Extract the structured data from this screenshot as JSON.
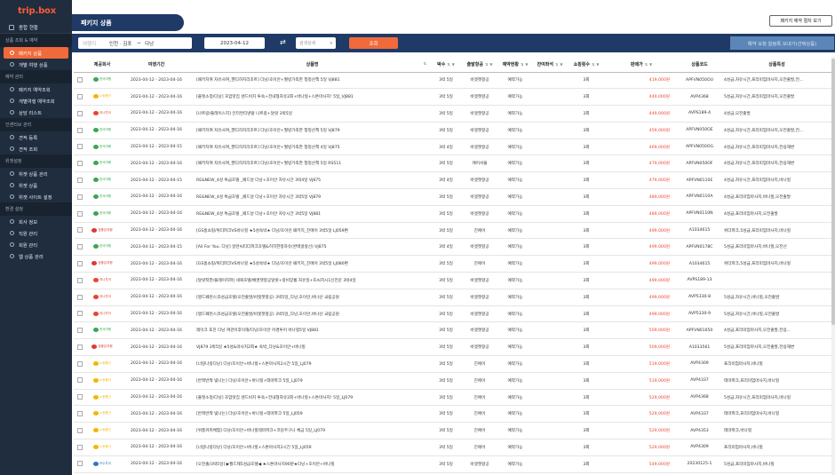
{
  "sidebar": {
    "logo": "trip.box",
    "top_item": "종합 현황",
    "sections": [
      {
        "title": "상품 조회 & 예약",
        "items": [
          {
            "label": "패키지 상품",
            "active": true
          },
          {
            "label": "개별 여행 상품",
            "active": false
          }
        ]
      },
      {
        "title": "예약 관리",
        "items": [
          {
            "label": "패키지 예약조회",
            "active": false
          },
          {
            "label": "개별여행 예약조회",
            "active": false
          },
          {
            "label": "상담 리스트",
            "active": false
          }
        ]
      },
      {
        "title": "인센티브 관리",
        "items": [
          {
            "label": "견적 등록",
            "active": false
          },
          {
            "label": "견적 조회",
            "active": false
          }
        ]
      },
      {
        "title": "위젯설정",
        "items": [
          {
            "label": "위젯 상품 관리",
            "active": false
          },
          {
            "label": "위젯 상품",
            "active": false
          },
          {
            "label": "위젯 사이트 설정",
            "active": false
          }
        ]
      },
      {
        "title": "환경 설정",
        "items": [
          {
            "label": "회사 정보",
            "active": false
          },
          {
            "label": "직원 관리",
            "active": false
          },
          {
            "label": "회원 관리",
            "active": false
          },
          {
            "label": "웹 상품 관리",
            "active": false
          }
        ]
      }
    ]
  },
  "header": {
    "title": "패키지 상품",
    "guide_button": "패키지 예약 절차 보기"
  },
  "search": {
    "route_prefix": "여행지",
    "from": "인천 · 김포",
    "arrow": "→",
    "to": "다낭",
    "date": "2023-04-12",
    "select_placeholder": "검색상세",
    "search_button": "조회",
    "request_button": "예약 요청 알림톡 보내기(선택상품)"
  },
  "table": {
    "columns": [
      "제공회사",
      "여행기간",
      "상품명",
      "박수",
      "출발항공",
      "예약현황",
      "잔여좌석",
      "쇼핑횟수",
      "판매가",
      "상품코드",
      "상품특성"
    ],
    "airlines": {
      "A": {
        "text": "한국여행",
        "color": "#3aa655"
      },
      "B": {
        "text": "노랑풍선",
        "color": "#f2b705"
      },
      "C": {
        "text": "하나투어",
        "color": "#e8452c"
      },
      "D": {
        "text": "참좋은여행",
        "color": "#d93a3a"
      },
      "E": {
        "text": "모두투어",
        "color": "#2e75c9"
      }
    },
    "rows": [
      {
        "co": "A",
        "period": "2023-04-12 - 2023-04-16",
        "name": "[패키지여 자유사여_핸디하지리조트] 다낭/호이안+월빙가족한 청정산책 5일 VJ881",
        "nights": "3박 5일",
        "air": "비엣젯항공",
        "status": "예약가능",
        "seats": "",
        "shop": "3회",
        "price": "419,000원",
        "code": "APFVN050OU",
        "feat": "4성급,자유시간,프리미엄마사지,오전출발,전..."
      },
      {
        "co": "B",
        "period": "2023-04-12 - 2023-04-16",
        "name": "[플렛소정/다낭] 호암맛집 샌드비치 투숙+전내형자유2회+바나힐+스톤마사지! 5일_VJ881",
        "nights": "3박 5일",
        "air": "비엣젯항공",
        "status": "예약가능",
        "seats": "",
        "shop": "3회",
        "price": "449,000원",
        "code": "AVP4368",
        "feat": "5성급,자유시간,프리미엄마사지,오전출발"
      },
      {
        "co": "C",
        "period": "2023-04-12 - 2023-04-16",
        "name": "[나트랑/플레이스지] 인터컨티넨탈 나트랑+달랏 3박5일",
        "nights": "3박 5일",
        "air": "비엣젯항공",
        "status": "예약가능",
        "seats": "",
        "shop": "3회",
        "price": "449,000원",
        "code": "AVPS189-4",
        "feat": "4성급,오전출발"
      },
      {
        "co": "A",
        "period": "2023-04-12 - 2023-04-16",
        "name": "[패키지여 자유사여_핸디하지리조트] 다낭/호이안+월빙가족한 청정산책 5일 VJ879",
        "nights": "3박 5일",
        "air": "비엣젯항공",
        "status": "예약가능",
        "seats": "",
        "shop": "3회",
        "price": "459,000원",
        "code": "APFVN050OE",
        "feat": "4성급,자유시간,프리미엄마사지,오전출발,전..."
      },
      {
        "co": "A",
        "period": "2023-04-12 - 2023-04-15",
        "name": "[패키지여 자유사여_핸디하지리조트] 다낭/호이안+월빙가족한 청정산책 4일 VJ875",
        "nights": "3박 4일",
        "air": "비엣젯항공",
        "status": "예약가능",
        "seats": "",
        "shop": "3회",
        "price": "469,000원",
        "code": "APFVN050OG",
        "feat": "4성급,자유시간,프리미엄마사지,전용해변"
      },
      {
        "co": "A",
        "period": "2023-04-12 - 2023-04-16",
        "name": "[패키지여 자유사여_핸디하지리조트] 다낭/호이안+월빙가족한 청정산책 5일 RS511",
        "nights": "3박 5일",
        "air": "에어서울",
        "status": "예약가능",
        "seats": "",
        "shop": "3회",
        "price": "479,000원",
        "code": "APFVN050OF",
        "feat": "4성급,자유시간,프리미엄마사지,전용해변"
      },
      {
        "co": "A",
        "period": "2023-04-12 - 2023-04-15",
        "name": "RE&NEW_4성 특급호텔 _페드날 다낭+호이안 자유시간 3박4일 VJ875",
        "nights": "3박 4일",
        "air": "비엣젯항공",
        "status": "예약가능",
        "seats": "",
        "shop": "3회",
        "price": "479,000원",
        "code": "APFVN0110E",
        "feat": "4성급,자유시간,프리미엄마사지,바나힐"
      },
      {
        "co": "A",
        "period": "2023-04-12 - 2023-04-16",
        "name": "RE&NEW_4성 특급호텔 _페드날 다낭+호이안 자유시간 3박5일 VJ879",
        "nights": "3박 5일",
        "air": "비엣젯항공",
        "status": "예약가능",
        "seats": "",
        "shop": "3회",
        "price": "489,000원",
        "code": "APFVN0110A",
        "feat": "4성급,프리미엄마사지,바나힐,오전출발"
      },
      {
        "co": "A",
        "period": "2023-04-12 - 2023-04-16",
        "name": "RE&NEW_4성 특급호텔 _페드날 다낭+호이안 자유시간 3박5일 VJ881",
        "nights": "3박 5일",
        "air": "비엣젯항공",
        "status": "예약가능",
        "seats": "",
        "shop": "3회",
        "price": "489,000원",
        "code": "APFVN0110N",
        "feat": "4성급,프리미엄마사지,오전출발"
      },
      {
        "co": "D",
        "period": "2023-04-12 - 2023-04-16",
        "name": "[GS홈쇼핑/위더파크VS바나힐 ★5성숙박★ 다낭/호이안 패키지_진에어 3박5일 LJ059편",
        "nights": "3박 5일",
        "air": "진에어",
        "status": "예약가능",
        "seats": "",
        "shop": "3회",
        "price": "499,000원",
        "code": "A1034615",
        "feat": "위더파크,5성급,프리미엄마사지,바나힐"
      },
      {
        "co": "A",
        "period": "2023-04-12 - 2023-04-15",
        "name": "[All For You. 다낭] 알란씨티더파크호텔&히히한정자유(완벽골랑선) VJ875",
        "nights": "3박 4일",
        "air": "비엣젯항공",
        "status": "예약가능",
        "seats": "",
        "shop": "3회",
        "price": "499,000원",
        "code": "APFVN0178C",
        "feat": "5성급,프리미엄마사지,바나힐,오전선"
      },
      {
        "co": "D",
        "period": "2023-04-12 - 2023-04-16",
        "name": "[GS홈쇼핑/위더파크VS바나힐 ★5성숙박★ 다낭/호이안 패키지_진에어 3박5일 LJ080편",
        "nights": "3박 5일",
        "air": "진에어",
        "status": "예약가능",
        "seats": "",
        "shop": "3회",
        "price": "499,000원",
        "code": "A1034615",
        "feat": "위더파크,5성급,프리미엄마사지,바나힐"
      },
      {
        "co": "C",
        "period": "2023-04-12 - 2023-04-16",
        "name": "[달랏착한/플레이지파] 세쿼호텔/베앤젯항공달랏+랑비앙휠 자유일+뜨씨지시1신전운 3박4일",
        "nights": "3박 5일",
        "air": "비엣젯항공",
        "status": "예약가능",
        "seats": "",
        "shop": "3회",
        "price": "499,000원",
        "code": "AVPS189-13",
        "feat": ""
      },
      {
        "co": "C",
        "period": "2023-04-12 - 2023-04-16",
        "name": "[랭드페런스]5성급호텔(오전출발/비엣젯항공) 3박5일_다낭,호이안,바나산 국립공원",
        "nights": "3박 5일",
        "air": "비엣젯항공",
        "status": "예약가능",
        "seats": "",
        "shop": "3회",
        "price": "499,000원",
        "code": "AVP5330-8",
        "feat": "5성급,자유시간,바나힐,오전출발"
      },
      {
        "co": "C",
        "period": "2023-04-12 - 2023-04-16",
        "name": "[랭드페런스]5성급호텔(오전출발/비엣젯항공) 3박5일_다낭,호이안,바나산 국립공원",
        "nights": "3박 5일",
        "air": "비엣젯항공",
        "status": "예약가능",
        "seats": "",
        "shop": "3회",
        "price": "499,000원",
        "code": "AVP5330-9",
        "feat": "5성급,자유시간,바나힐,오전출발"
      },
      {
        "co": "A",
        "period": "2023-04-12 - 2023-04-16",
        "name": "레이크 포진 다낭 여관이후이해/다낭/호이안 어경투어 바나힐5일 VJ881",
        "nights": "3박 5일",
        "air": "비엣젯항공",
        "status": "예약가능",
        "seats": "",
        "shop": "3회",
        "price": "509,000원",
        "code": "APFVN01650",
        "feat": "4성급,프리미엄마사지,오전출발,전용..."
      },
      {
        "co": "D",
        "period": "2023-04-12 - 2023-04-16",
        "name": "VJ879 3박5일 ★5성&마사지2회★ 숙박_다낭&호이안+바나힐",
        "nights": "3박 5일",
        "air": "비엣젯항공",
        "status": "예약가능",
        "seats": "",
        "shop": "3회",
        "price": "509,000원",
        "code": "A1033561",
        "feat": "5성급,프리미엄마사지,오전출발,전용해변"
      },
      {
        "co": "B",
        "period": "2023-04-12 - 2023-04-16",
        "name": "[너랑나랑다낭] 다낭/호이안+바나힐+스톤마사지2시간 5일_LJ079",
        "nights": "3박 5일",
        "air": "진에어",
        "status": "예약가능",
        "seats": "",
        "shop": "3회",
        "price": "519,000원",
        "code": "AVP4309",
        "feat": "프리미엄마사지,바나힐"
      },
      {
        "co": "B",
        "period": "2023-04-12 - 2023-04-16",
        "name": "[반짝반짝 빛나는] 다낭/호이안+바나힐+테마파크 5일_LJ079",
        "nights": "3박 5일",
        "air": "진에어",
        "status": "예약가능",
        "seats": "",
        "shop": "3회",
        "price": "519,000원",
        "code": "AVP4337",
        "feat": "테마파크,프리미엄마사지,바나힐"
      },
      {
        "co": "B",
        "period": "2023-04-12 - 2023-04-16",
        "name": "[플렛소정/다낭] 호암맛집 샌드비치 투숙+전내형자유2회+바나힐+스톤마사지! 5일_LJ079",
        "nights": "3박 5일",
        "air": "진에어",
        "status": "예약가능",
        "seats": "",
        "shop": "3회",
        "price": "529,000원",
        "code": "AVP4368",
        "feat": "5성급,자유시간,프리미엄마사지,바나힐"
      },
      {
        "co": "B",
        "period": "2023-04-12 - 2023-04-16",
        "name": "[반짝반짝 빛나는] 다낭/호이안+바나힐+테마파크 5일_LJ059",
        "nights": "3박 5일",
        "air": "진에어",
        "status": "예약가능",
        "seats": "",
        "shop": "3회",
        "price": "529,000원",
        "code": "AVP4337",
        "feat": "테마파크,프리미엄마사지,바나힐"
      },
      {
        "co": "B",
        "period": "2023-04-12 - 2023-04-16",
        "name": "[위풍커피체험] 다낭/호이안+바나힐테마파크+코담주구니 체금 5일_LJ079",
        "nights": "3박 5일",
        "air": "진에어",
        "status": "예약가능",
        "seats": "",
        "shop": "3회",
        "price": "529,000원",
        "code": "AVP4353",
        "feat": "테마파크,바나힐"
      },
      {
        "co": "B",
        "period": "2023-04-12 - 2023-04-16",
        "name": "[너랑나랑다낭] 다낭/호이안+바나힐+스톤마사지2시간 5일_LJ059",
        "nights": "3박 5일",
        "air": "진에어",
        "status": "예약가능",
        "seats": "",
        "shop": "3회",
        "price": "529,000원",
        "code": "AVP4309",
        "feat": "프리미엄마사지,바나힐"
      },
      {
        "co": "E",
        "period": "2023-04-12 - 2023-04-16",
        "name": "[오전출/3박5일] ▶월드제5성급호텔◀ ★스톤마사지90분★다낭+호이안+바나힐",
        "nights": "3박 5일",
        "air": "비엣젯항공",
        "status": "예약가능",
        "seats": "",
        "shop": "3회",
        "price": "549,000원",
        "code": "20230125-1",
        "feat": "5성급,프리미엄마사지,바나힐"
      },
      {
        "co": "C",
        "period": "2023-04-12 - 2023-04-16",
        "name": "[오전출/3박5일] 다낭/호이안+바나힐+스톤마사지 5일",
        "nights": "3박 5일",
        "air": "비엣젯항공",
        "status": "예약가능",
        "seats": "",
        "shop": "3회",
        "price": "549,000원",
        "code": "AVP4392",
        "feat": "5성급,프리미엄마사지"
      }
    ]
  }
}
